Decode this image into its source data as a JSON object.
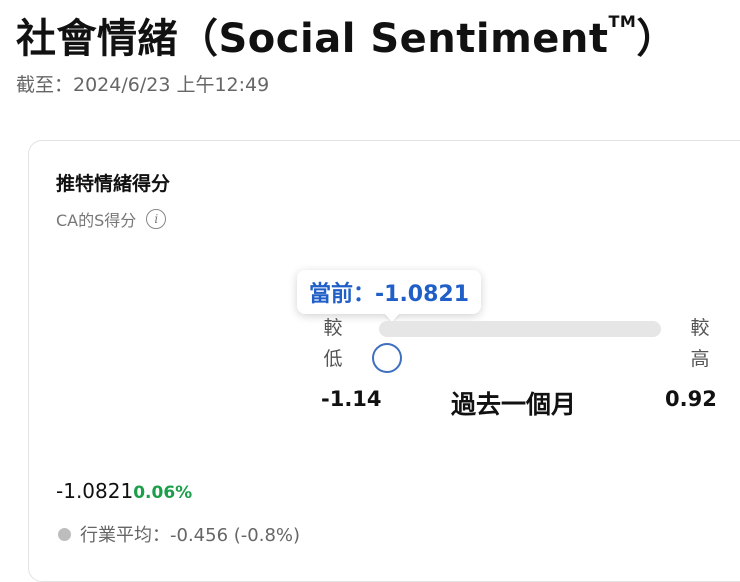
{
  "header": {
    "title": "社會情緒（Social Sentiment",
    "trademark": "TM",
    "title_close": "）",
    "updated": "截至：2024/6/23 上午12:49"
  },
  "card": {
    "title": "推特情緒得分",
    "subtitle": "CA的S得分",
    "info_icon": "info-icon",
    "tooltip": "當前：-1.0821",
    "slider": {
      "low_label_1": "較",
      "low_label_2": "低",
      "high_label_1": "較",
      "high_label_2": "高",
      "min": "-1.14",
      "max": "0.92",
      "min_value": -1.14,
      "max_value": 0.92,
      "current_value": -1.0821,
      "period": "過去一個月"
    },
    "current_value": "-1.0821",
    "current_change": "0.06%",
    "industry_average": "行業平均：-0.456 (-0.8%)"
  },
  "colors": {
    "accent": "#1f5fc7",
    "positive": "#1a9e4a",
    "track": "#e6e6e6",
    "thumb_border": "#3f6fbf"
  }
}
